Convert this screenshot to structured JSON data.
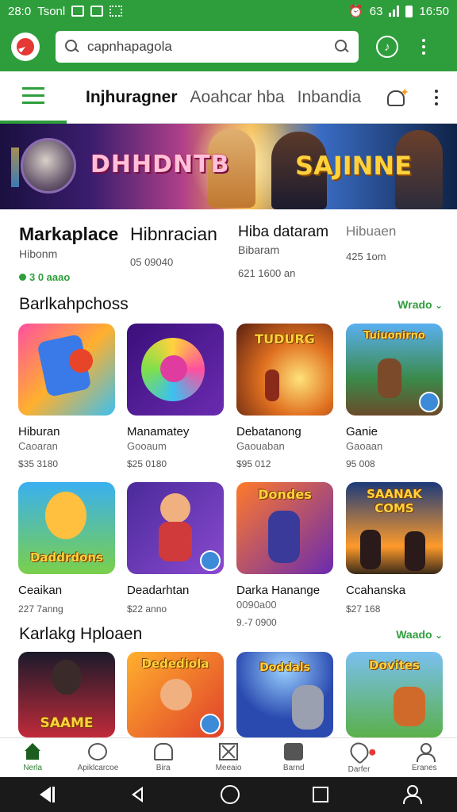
{
  "status_bar": {
    "time_left": "28:0",
    "carrier": "Tsonl",
    "battery_pct": "63",
    "time_right": "16:50"
  },
  "search": {
    "value": "capnhapagola"
  },
  "tabs": {
    "active": "Injhuragner",
    "tab2": "Aoahcar hba",
    "tab3": "Inbandia"
  },
  "banner": {
    "text_left": "DHHDNTB",
    "text_right": "SAJINNE"
  },
  "stats": [
    {
      "title": "Markaplace",
      "sub": "Hibonm",
      "value": "3 0 aaao"
    },
    {
      "title": "Hibnracian",
      "sub": "",
      "value": "05 09040"
    },
    {
      "title": "Hiba dataram",
      "sub": "Bibaram",
      "value": "621 1600 an"
    },
    {
      "title": "Hibuaen",
      "sub": "",
      "value": "425 1om"
    }
  ],
  "section1": {
    "heading": "Barlkahpchoss",
    "more": "Wrado",
    "cards": [
      {
        "name": "Hiburan",
        "category": "Caoaran",
        "price": "$35 3180",
        "label": ""
      },
      {
        "name": "Manamatey",
        "category": "Gooaum",
        "price": "$25 0180",
        "label": ""
      },
      {
        "name": "Debatanong",
        "category": "Gaouaban",
        "price": "$95 012",
        "label": "TUDURG"
      },
      {
        "name": "Ganie",
        "category": "Gaoaan",
        "price": "95 008",
        "label": "Tuiuonirno"
      },
      {
        "name": "Ceaikan",
        "category": "",
        "price": "227 7anng",
        "label": "Daddrdons"
      },
      {
        "name": "Deadarhtan",
        "category": "",
        "price": "$22 anno",
        "label": ""
      },
      {
        "name": "Darka Hanange",
        "category": "0090a00",
        "price": "9.-7 0900",
        "label": "Dondes"
      },
      {
        "name": "Ccahanska",
        "category": "",
        "price": "$27 168",
        "label": "SAANAK COMS"
      }
    ]
  },
  "section2": {
    "heading": "Karlakg Hploaen",
    "more": "Waado",
    "cards": [
      {
        "label": "SAAME"
      },
      {
        "label": "Dedediola"
      },
      {
        "label": "Doddals"
      },
      {
        "label": "Dovites"
      }
    ]
  },
  "bottom_nav": [
    {
      "label": "Nerla",
      "icon": "home-icon"
    },
    {
      "label": "Apiklcarcoe",
      "icon": "wrench-icon"
    },
    {
      "label": "Bira",
      "icon": "house-outline-icon"
    },
    {
      "label": "Meeaio",
      "icon": "close-box-icon"
    },
    {
      "label": "Barnd",
      "icon": "edit-icon"
    },
    {
      "label": "Darfer",
      "icon": "heart-icon"
    },
    {
      "label": "Eranes",
      "icon": "person-icon"
    }
  ],
  "colors": {
    "primary": "#2e9e3c",
    "accent": "#2e9e3c"
  }
}
